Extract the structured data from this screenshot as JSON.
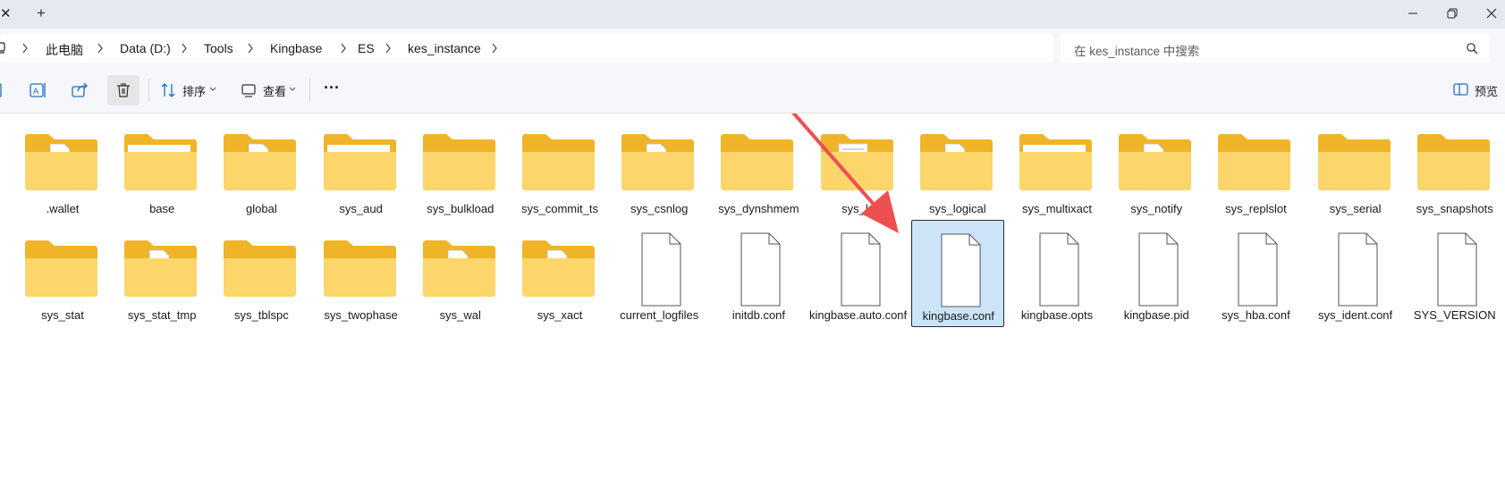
{
  "window": {
    "tab_close_glyph": "✕",
    "new_tab_glyph": "+"
  },
  "breadcrumb": {
    "items": [
      "此电脑",
      "Data (D:)",
      "Tools",
      "Kingbase",
      "ES",
      "kes_instance"
    ]
  },
  "search": {
    "placeholder": "在 kes_instance 中搜索"
  },
  "toolbar": {
    "sort_label": "排序",
    "view_label": "查看",
    "more_glyph": "···",
    "preview_label": "预览"
  },
  "files": [
    {
      "name": ".wallet",
      "type": "folder-doc"
    },
    {
      "name": "base",
      "type": "folder-pages"
    },
    {
      "name": "global",
      "type": "folder-doc"
    },
    {
      "name": "sys_aud",
      "type": "folder-pages"
    },
    {
      "name": "sys_bulkload",
      "type": "folder"
    },
    {
      "name": "sys_commit_ts",
      "type": "folder"
    },
    {
      "name": "sys_csnlog",
      "type": "folder-doc"
    },
    {
      "name": "sys_dynshmem",
      "type": "folder"
    },
    {
      "name": "sys_lo",
      "type": "folder-lines"
    },
    {
      "name": "sys_logical",
      "type": "folder-doc"
    },
    {
      "name": "sys_multixact",
      "type": "folder-pages"
    },
    {
      "name": "sys_notify",
      "type": "folder-doc"
    },
    {
      "name": "sys_replslot",
      "type": "folder"
    },
    {
      "name": "sys_serial",
      "type": "folder"
    },
    {
      "name": "sys_snapshots",
      "type": "folder"
    },
    {
      "name": "sys_stat",
      "type": "folder"
    },
    {
      "name": "sys_stat_tmp",
      "type": "folder-doc"
    },
    {
      "name": "sys_tblspc",
      "type": "folder"
    },
    {
      "name": "sys_twophase",
      "type": "folder"
    },
    {
      "name": "sys_wal",
      "type": "folder-doc"
    },
    {
      "name": "sys_xact",
      "type": "folder-doc"
    },
    {
      "name": "current_logfiles",
      "type": "file"
    },
    {
      "name": "initdb.conf",
      "type": "file"
    },
    {
      "name": "kingbase.auto.conf",
      "type": "file"
    },
    {
      "name": "kingbase.conf",
      "type": "file",
      "selected": true
    },
    {
      "name": "kingbase.opts",
      "type": "file"
    },
    {
      "name": "kingbase.pid",
      "type": "file"
    },
    {
      "name": "sys_hba.conf",
      "type": "file"
    },
    {
      "name": "sys_ident.conf",
      "type": "file"
    },
    {
      "name": "SYS_VERSION",
      "type": "file"
    }
  ],
  "colors": {
    "folder_back": "#f0b428",
    "folder_front": "#fcd56b",
    "arrow": "#ee4f4f",
    "selection": "#cce4f7"
  }
}
